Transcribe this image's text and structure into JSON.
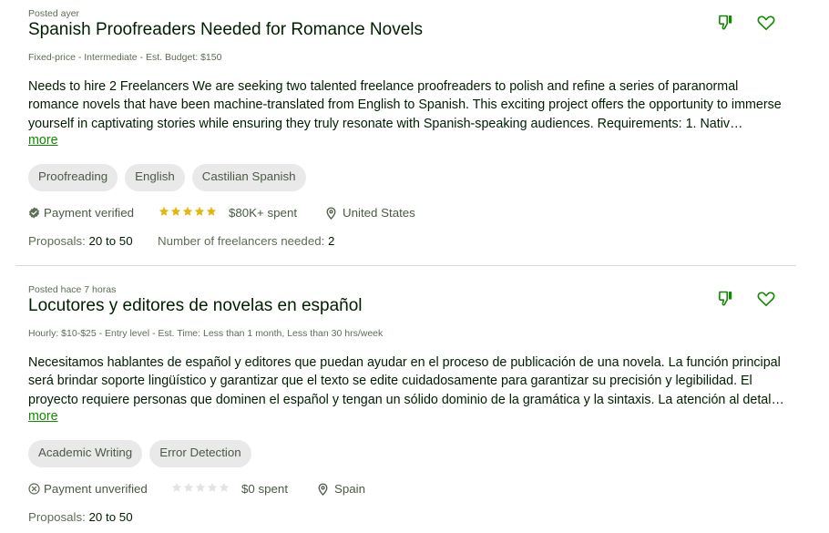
{
  "jobs": [
    {
      "posted": "Posted ayer",
      "title": "Spanish Proofreaders Needed for Romance Novels",
      "meta": "Fixed-price - Intermediate - Est. Budget: $150",
      "description_lines": [
        "Needs to hire 2 Freelancers We are seeking two talented freelance proofreaders to polish and refine a series of paranormal",
        "romance novels that have been machine-translated from English to Spanish. This exciting project offers the opportunity to immerse",
        "yourself in captivating stories while ensuring they truly resonate with Spanish-speaking audiences.  Requirements: 1. Native…"
      ],
      "more_label": "more",
      "skills": [
        "Proofreading",
        "English",
        "Castilian Spanish"
      ],
      "payment_status": "Payment verified",
      "payment_icon": "verified-check-icon",
      "rating_stars": 5,
      "rating_max": 5,
      "spent": "$80K+ spent",
      "location": "United States",
      "proposals_label": "Proposals:",
      "proposals_value": "20 to 50",
      "freelancers_label": "Number of freelancers needed:",
      "freelancers_value": "2"
    },
    {
      "posted": "Posted hace 7 horas",
      "title": "Locutores y editores de novelas en español",
      "meta": "Hourly: $10-$25 - Entry level - Est. Time: Less than 1 month, Less than 30 hrs/week",
      "description_lines": [
        "Necesitamos hablantes de español y editores que puedan ayudar en el proceso de publicación de una novela. La función principal",
        "será brindar soporte lingüístico y garantizar que el texto se edite cuidadosamente para garantizar su precisión y legibilidad. El",
        "proyecto requiere personas que dominen el español y tengan un sólido dominio de la gramática y la sintaxis. La atención al detalle…"
      ],
      "more_label": "more",
      "skills": [
        "Academic Writing",
        "Error Detection"
      ],
      "payment_status": "Payment unverified",
      "payment_icon": "unverified-x-icon",
      "rating_stars": 0,
      "rating_max": 5,
      "spent": "$0 spent",
      "location": "Spain",
      "proposals_label": "Proposals:",
      "proposals_value": "20 to 50"
    }
  ],
  "colors": {
    "accent_green": "#108a00",
    "star_filled": "#e2b80d",
    "star_empty": "#e3e3e3",
    "tag_bg": "#e9e9e9",
    "divider": "#d5e0d5"
  }
}
